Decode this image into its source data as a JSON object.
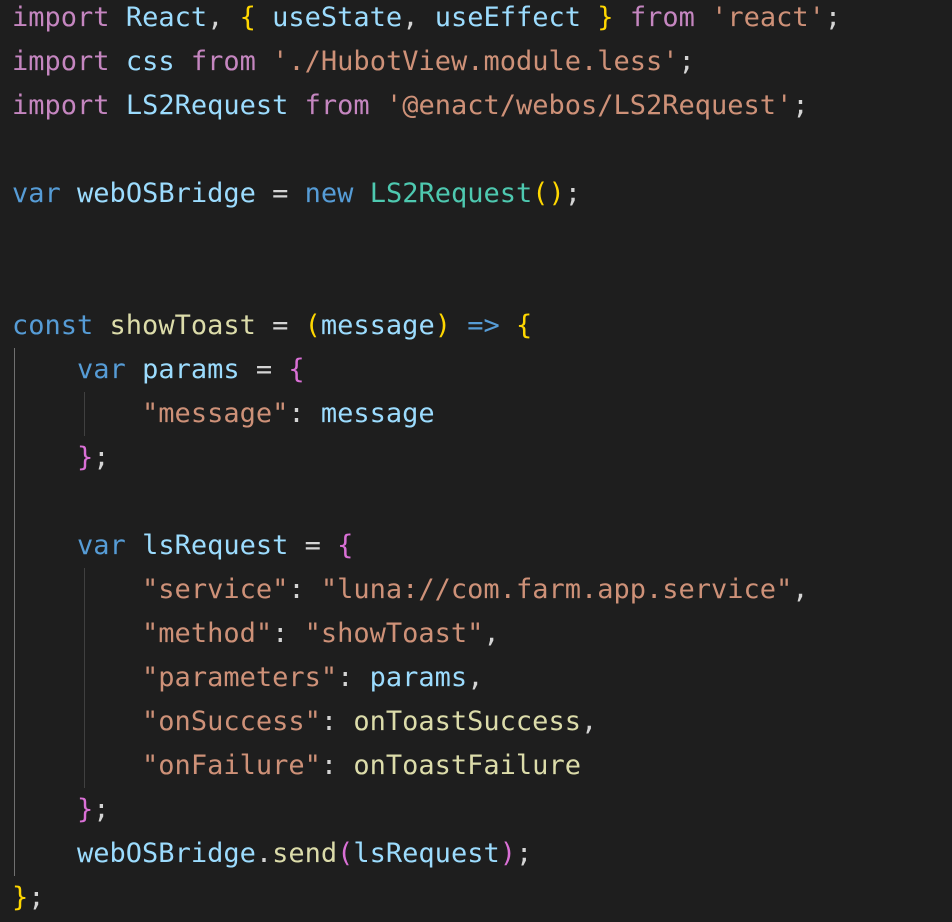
{
  "editor": {
    "theme_colors": {
      "background": "#1e1e1e",
      "keyword_control": "#c586c0",
      "keyword": "#569cd6",
      "variable": "#9cdcfe",
      "string": "#ce9178",
      "function": "#dcdcaa",
      "class": "#4ec9b0",
      "punctuation": "#d4d4d4",
      "bracket_level1": "#ffd700",
      "bracket_level2": "#da70d6",
      "bracket_level3": "#179fff"
    },
    "lines": [
      {
        "tokens": [
          [
            "kw-ctrl",
            "import"
          ],
          [
            "pun",
            " "
          ],
          [
            "var",
            "React"
          ],
          [
            "pun",
            ", "
          ],
          [
            "br1",
            "{"
          ],
          [
            "pun",
            " "
          ],
          [
            "var",
            "useState"
          ],
          [
            "pun",
            ", "
          ],
          [
            "var",
            "useEffect"
          ],
          [
            "pun",
            " "
          ],
          [
            "br1",
            "}"
          ],
          [
            "pun",
            " "
          ],
          [
            "kw-ctrl",
            "from"
          ],
          [
            "pun",
            " "
          ],
          [
            "str",
            "'react'"
          ],
          [
            "pun",
            ";"
          ]
        ]
      },
      {
        "tokens": [
          [
            "kw-ctrl",
            "import"
          ],
          [
            "pun",
            " "
          ],
          [
            "var",
            "css"
          ],
          [
            "pun",
            " "
          ],
          [
            "kw-ctrl",
            "from"
          ],
          [
            "pun",
            " "
          ],
          [
            "str",
            "'./HubotView.module.less'"
          ],
          [
            "pun",
            ";"
          ]
        ]
      },
      {
        "tokens": [
          [
            "kw-ctrl",
            "import"
          ],
          [
            "pun",
            " "
          ],
          [
            "var",
            "LS2Request"
          ],
          [
            "pun",
            " "
          ],
          [
            "kw-ctrl",
            "from"
          ],
          [
            "pun",
            " "
          ],
          [
            "str",
            "'@enact/webos/LS2Request'"
          ],
          [
            "pun",
            ";"
          ]
        ]
      },
      {
        "tokens": []
      },
      {
        "tokens": [
          [
            "kw",
            "var"
          ],
          [
            "pun",
            " "
          ],
          [
            "var",
            "webOSBridge"
          ],
          [
            "pun",
            " = "
          ],
          [
            "kw",
            "new"
          ],
          [
            "pun",
            " "
          ],
          [
            "cls",
            "LS2Request"
          ],
          [
            "br1",
            "("
          ],
          [
            "br1",
            ")"
          ],
          [
            "pun",
            ";"
          ]
        ]
      },
      {
        "tokens": []
      },
      {
        "tokens": []
      },
      {
        "tokens": [
          [
            "kw",
            "const"
          ],
          [
            "pun",
            " "
          ],
          [
            "fn",
            "showToast"
          ],
          [
            "pun",
            " = "
          ],
          [
            "br1",
            "("
          ],
          [
            "var",
            "message"
          ],
          [
            "br1",
            ")"
          ],
          [
            "pun",
            " "
          ],
          [
            "arrow",
            "=>"
          ],
          [
            "pun",
            " "
          ],
          [
            "br1",
            "{"
          ]
        ]
      },
      {
        "tokens": [
          [
            "pun",
            "    "
          ],
          [
            "kw",
            "var"
          ],
          [
            "pun",
            " "
          ],
          [
            "var",
            "params"
          ],
          [
            "pun",
            " = "
          ],
          [
            "br2",
            "{"
          ]
        ]
      },
      {
        "tokens": [
          [
            "pun",
            "        "
          ],
          [
            "str",
            "\"message\""
          ],
          [
            "pun",
            ": "
          ],
          [
            "var",
            "message"
          ]
        ]
      },
      {
        "tokens": [
          [
            "pun",
            "    "
          ],
          [
            "br2",
            "}"
          ],
          [
            "pun",
            ";"
          ]
        ]
      },
      {
        "tokens": []
      },
      {
        "tokens": [
          [
            "pun",
            "    "
          ],
          [
            "kw",
            "var"
          ],
          [
            "pun",
            " "
          ],
          [
            "var",
            "lsRequest"
          ],
          [
            "pun",
            " = "
          ],
          [
            "br2",
            "{"
          ]
        ]
      },
      {
        "tokens": [
          [
            "pun",
            "        "
          ],
          [
            "str",
            "\"service\""
          ],
          [
            "pun",
            ": "
          ],
          [
            "str",
            "\"luna://com.farm.app.service\""
          ],
          [
            "pun",
            ","
          ]
        ]
      },
      {
        "tokens": [
          [
            "pun",
            "        "
          ],
          [
            "str",
            "\"method\""
          ],
          [
            "pun",
            ": "
          ],
          [
            "str",
            "\"showToast\""
          ],
          [
            "pun",
            ","
          ]
        ]
      },
      {
        "tokens": [
          [
            "pun",
            "        "
          ],
          [
            "str",
            "\"parameters\""
          ],
          [
            "pun",
            ": "
          ],
          [
            "var",
            "params"
          ],
          [
            "pun",
            ","
          ]
        ]
      },
      {
        "tokens": [
          [
            "pun",
            "        "
          ],
          [
            "str",
            "\"onSuccess\""
          ],
          [
            "pun",
            ": "
          ],
          [
            "fn",
            "onToastSuccess"
          ],
          [
            "pun",
            ","
          ]
        ]
      },
      {
        "tokens": [
          [
            "pun",
            "        "
          ],
          [
            "str",
            "\"onFailure\""
          ],
          [
            "pun",
            ": "
          ],
          [
            "fn",
            "onToastFailure"
          ]
        ]
      },
      {
        "tokens": [
          [
            "pun",
            "    "
          ],
          [
            "br2",
            "}"
          ],
          [
            "pun",
            ";"
          ]
        ]
      },
      {
        "tokens": [
          [
            "pun",
            "    "
          ],
          [
            "var",
            "webOSBridge"
          ],
          [
            "pun",
            "."
          ],
          [
            "fn",
            "send"
          ],
          [
            "br2",
            "("
          ],
          [
            "var",
            "lsRequest"
          ],
          [
            "br2",
            ")"
          ],
          [
            "pun",
            ";"
          ]
        ]
      },
      {
        "tokens": [
          [
            "br1",
            "}"
          ],
          [
            "pun",
            ";"
          ]
        ]
      }
    ]
  }
}
